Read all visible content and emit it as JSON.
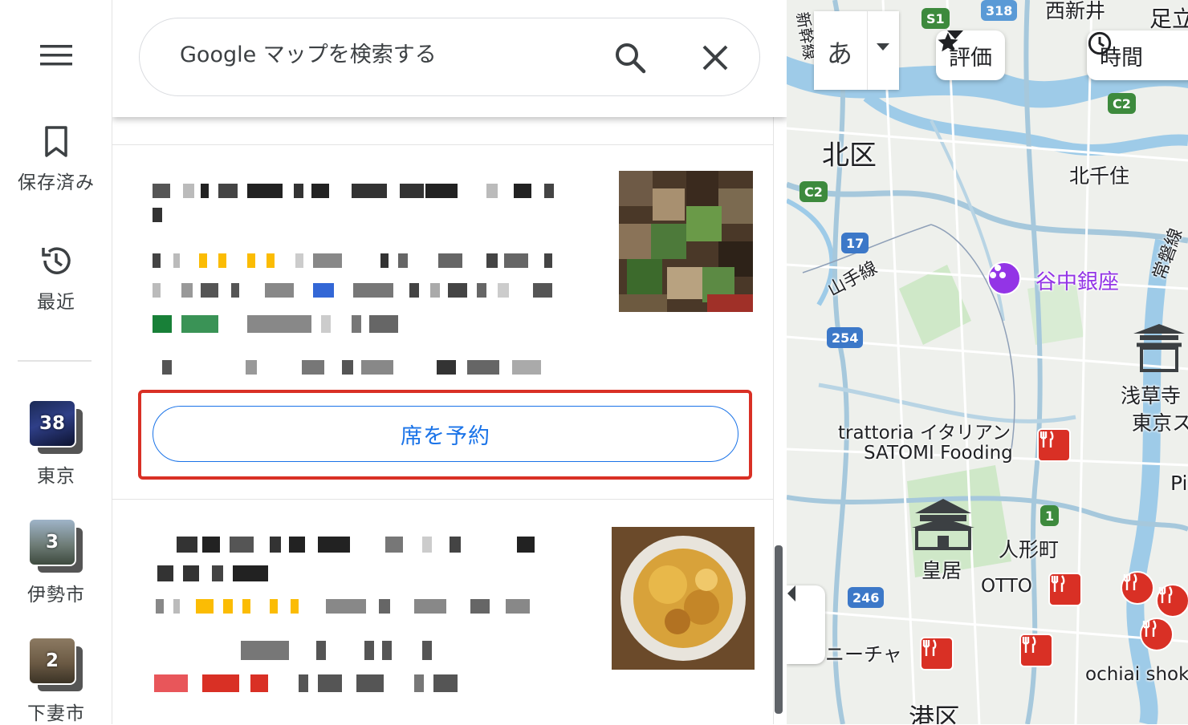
{
  "rail": {
    "menu_icon": "menu-icon",
    "saved_label": "保存済み",
    "recent_label": "最近",
    "places": [
      {
        "label": "東京",
        "count": "38"
      },
      {
        "label": "伊勢市",
        "count": "3"
      },
      {
        "label": "下妻市",
        "count": "2"
      }
    ]
  },
  "search": {
    "placeholder": "Google マップを検索する",
    "search_icon": "search-icon",
    "clear_icon": "close-icon"
  },
  "results": {
    "reserve_label": "席を予約"
  },
  "map": {
    "lang_label": "あ",
    "chips": [
      {
        "label": "評価",
        "icon": "star-icon"
      },
      {
        "label": "時間",
        "icon": "clock-icon"
      }
    ],
    "labels": {
      "nishiarai": "西新井",
      "kita": "北区",
      "kitasenju": "北千住",
      "yamanote": "山手線",
      "yanaka": "谷中銀座",
      "trattoria1": "trattoria イタリアン",
      "trattoria2": "SATOMI Fooding",
      "sensoji": "浅草寺",
      "tokyo": "東京ス",
      "kokyo": "皇居",
      "ningyocho": "人形町",
      "otto": "OTTO",
      "nicha": "ニーチャ",
      "minato": "港区",
      "ochiai": "ochiai shok",
      "joban": "常磐線",
      "shinkansen": "新幹線",
      "ashi": "足立",
      "pi": "Pi"
    },
    "routes": [
      "318",
      "S1",
      "C2",
      "C2",
      "17",
      "254",
      "1",
      "246"
    ]
  },
  "colors": {
    "accent": "#1a73e8",
    "highlight": "#d93025",
    "rating": "#fbbc04",
    "open": "#188038"
  }
}
